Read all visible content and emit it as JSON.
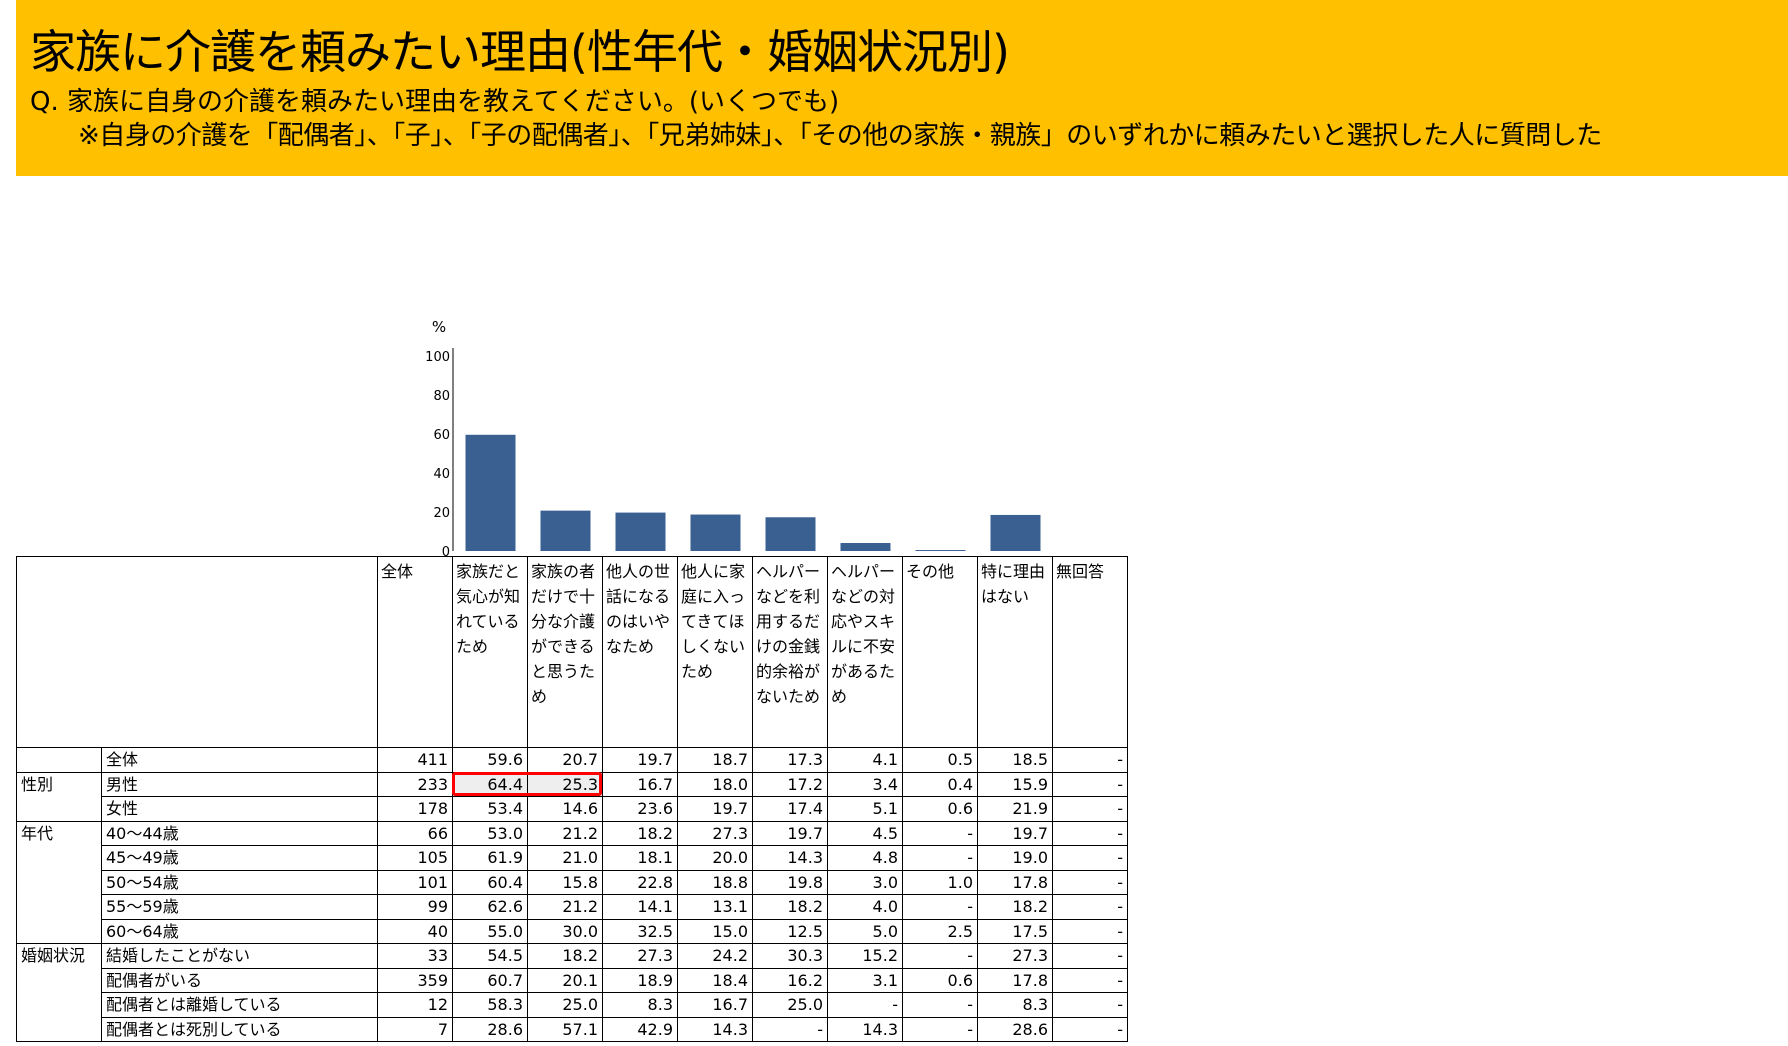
{
  "header": {
    "title": "家族に介護を頼みたい理由(性年代・婚姻状況別)",
    "question": "Q.  家族に自身の介護を頼みたい理由を教えてください。(いくつでも)",
    "note": "※自身の介護を「配偶者」、「子」、「子の配偶者」、「兄弟姉妹」、「その他の家族・親族」のいずれかに頼みたいと選択した人に質問した",
    "background_color": "#FFC000"
  },
  "chart_data": {
    "type": "bar",
    "unit_label": "%",
    "ylim": [
      0,
      100
    ],
    "yticks": [
      "100",
      "80",
      "60",
      "40",
      "20",
      "0"
    ],
    "bar_color": "#3A5F91",
    "categories": [
      "家族だと気心が知れているため",
      "家族の者だけで十分な介護ができると思うため",
      "他人の世話になるのはいやなため",
      "他人に家庭に入ってきてほしくないため",
      "ヘルパーなどを利用するだけの金銭的余裕がないため",
      "ヘルパーなどの対応やスキルに不安があるため",
      "その他",
      "特に理由はない",
      "無回答"
    ],
    "values": [
      59.6,
      20.7,
      19.7,
      18.7,
      17.3,
      4.1,
      0.5,
      18.5,
      0
    ]
  },
  "table": {
    "header_total": "全体",
    "columns": [
      "家族だと気心が知れているため",
      "家族の者だけで十分な介護ができると思うため",
      "他人の世話になるのはいやなため",
      "他人に家庭に入ってきてほしくないため",
      "ヘルパーなどを利用するだけの金銭的余裕がないため",
      "ヘルパーなどの対応やスキルに不安があるため",
      "その他",
      "特に理由はない",
      "無回答"
    ],
    "rows": [
      {
        "group": "",
        "label": "全体",
        "n": "411",
        "values": [
          "59.6",
          "20.7",
          "19.7",
          "18.7",
          "17.3",
          "4.1",
          "0.5",
          "18.5",
          "-"
        ]
      },
      {
        "group": "性別",
        "label": "男性",
        "n": "233",
        "values": [
          "64.4",
          "25.3",
          "16.7",
          "18.0",
          "17.2",
          "3.4",
          "0.4",
          "15.9",
          "-"
        ]
      },
      {
        "group": "",
        "label": "女性",
        "n": "178",
        "values": [
          "53.4",
          "14.6",
          "23.6",
          "19.7",
          "17.4",
          "5.1",
          "0.6",
          "21.9",
          "-"
        ]
      },
      {
        "group": "年代",
        "label": "40～44歳",
        "n": "66",
        "values": [
          "53.0",
          "21.2",
          "18.2",
          "27.3",
          "19.7",
          "4.5",
          "-",
          "19.7",
          "-"
        ]
      },
      {
        "group": "",
        "label": "45～49歳",
        "n": "105",
        "values": [
          "61.9",
          "21.0",
          "18.1",
          "20.0",
          "14.3",
          "4.8",
          "-",
          "19.0",
          "-"
        ]
      },
      {
        "group": "",
        "label": "50～54歳",
        "n": "101",
        "values": [
          "60.4",
          "15.8",
          "22.8",
          "18.8",
          "19.8",
          "3.0",
          "1.0",
          "17.8",
          "-"
        ]
      },
      {
        "group": "",
        "label": "55～59歳",
        "n": "99",
        "values": [
          "62.6",
          "21.2",
          "14.1",
          "13.1",
          "18.2",
          "4.0",
          "-",
          "18.2",
          "-"
        ]
      },
      {
        "group": "",
        "label": "60～64歳",
        "n": "40",
        "values": [
          "55.0",
          "30.0",
          "32.5",
          "15.0",
          "12.5",
          "5.0",
          "2.5",
          "17.5",
          "-"
        ]
      },
      {
        "group": "婚姻状況",
        "label": "結婚したことがない",
        "n": "33",
        "values": [
          "54.5",
          "18.2",
          "27.3",
          "24.2",
          "30.3",
          "15.2",
          "-",
          "27.3",
          "-"
        ]
      },
      {
        "group": "",
        "label": "配偶者がいる",
        "n": "359",
        "values": [
          "60.7",
          "20.1",
          "18.9",
          "18.4",
          "16.2",
          "3.1",
          "0.6",
          "17.8",
          "-"
        ]
      },
      {
        "group": "",
        "label": "配偶者とは離婚している",
        "n": "12",
        "values": [
          "58.3",
          "25.0",
          "8.3",
          "16.7",
          "25.0",
          "-",
          "-",
          "8.3",
          "-"
        ]
      },
      {
        "group": "",
        "label": "配偶者とは死別している",
        "n": "7",
        "values": [
          "28.6",
          "57.1",
          "42.9",
          "14.3",
          "-",
          "14.3",
          "-",
          "28.6",
          "-"
        ]
      }
    ],
    "highlight_color": "#FF0000"
  }
}
